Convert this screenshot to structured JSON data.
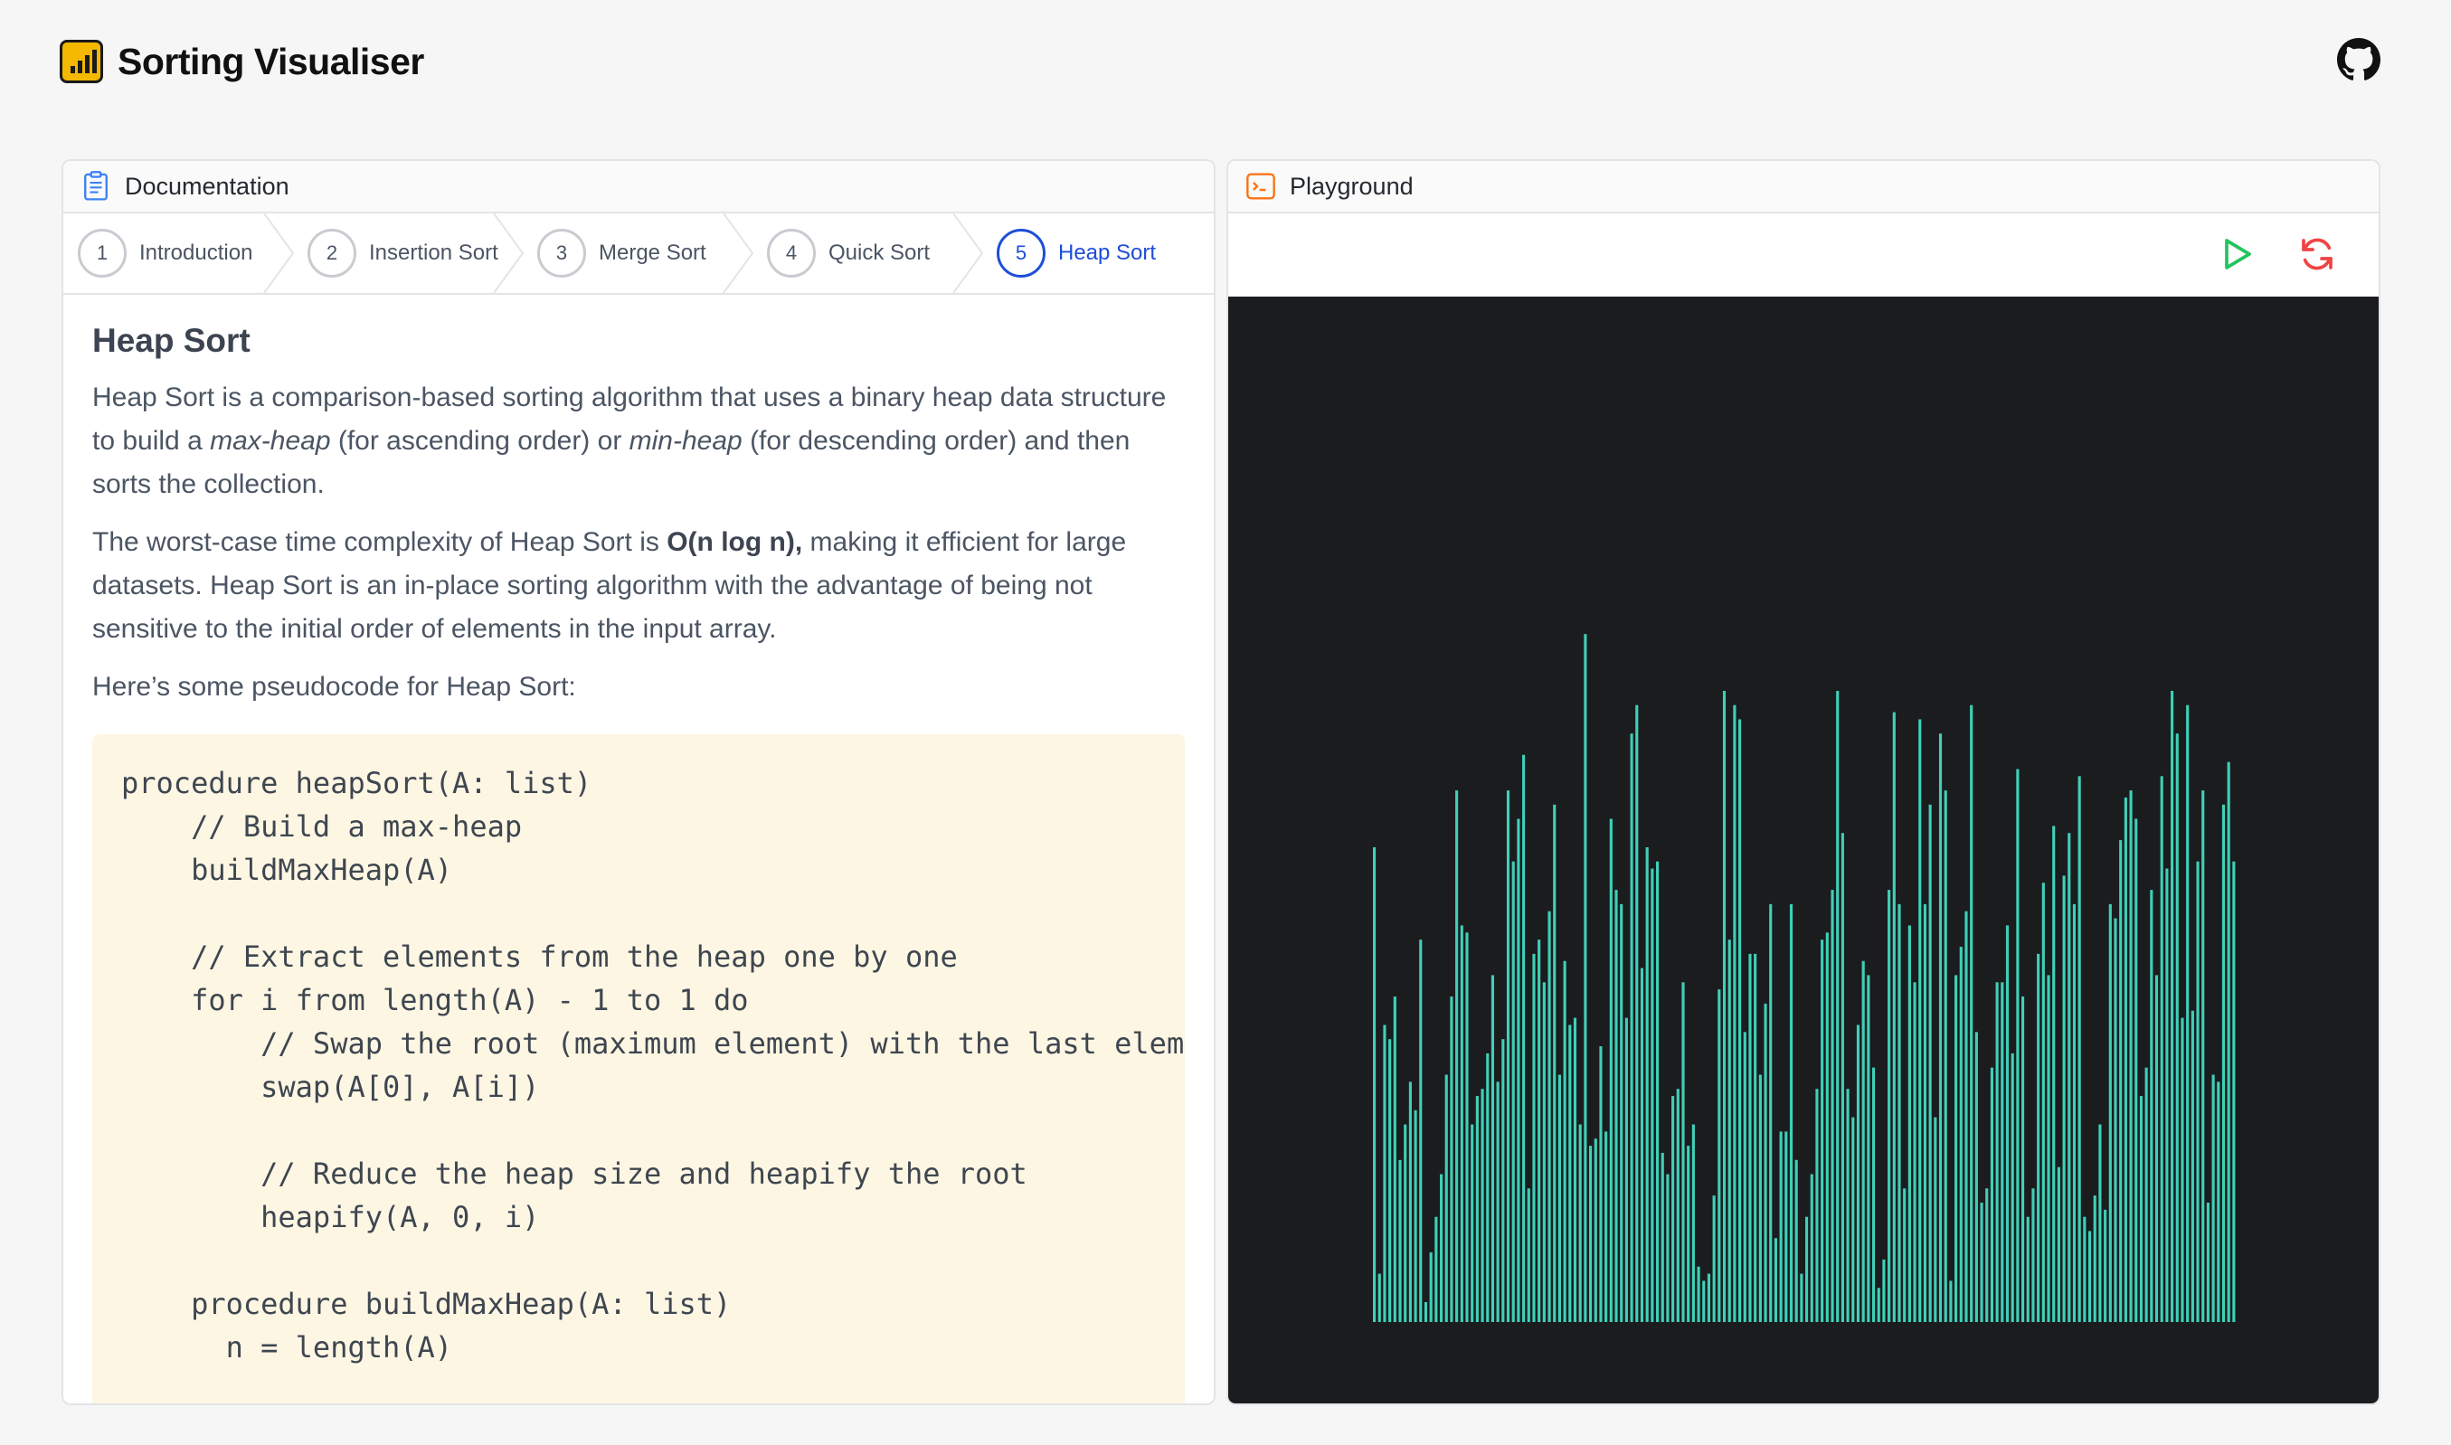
{
  "app": {
    "title": "Sorting Visualiser"
  },
  "icons": {
    "logo": "bar-chart-icon",
    "github": "github-icon",
    "docs": "clipboard-icon",
    "playground": "terminal-icon",
    "run": "play-icon",
    "reset": "refresh-icon"
  },
  "colors": {
    "accent": "#1d4ed8",
    "logo": "#f5b800",
    "bar": "#3fd0b8",
    "run": "#22c55e",
    "reset": "#ef4444",
    "canvas_bg": "#1b1c1e",
    "code_bg": "#fdf6e3"
  },
  "documentation": {
    "title": "Documentation",
    "steps": [
      {
        "num": "1",
        "label": "Introduction"
      },
      {
        "num": "2",
        "label": "Insertion Sort"
      },
      {
        "num": "3",
        "label": "Merge Sort"
      },
      {
        "num": "4",
        "label": "Quick Sort"
      },
      {
        "num": "5",
        "label": "Heap Sort"
      }
    ],
    "active_step": 5,
    "heading": "Heap Sort",
    "p1_a": "Heap Sort is a comparison-based sorting algorithm that uses a binary heap data structure to build a ",
    "p1_em1": "max-heap",
    "p1_b": " (for ascending order) or ",
    "p1_em2": "min-heap",
    "p1_c": " (for descending order) and then sorts the collection.",
    "p2_a": "The worst-case time complexity of Heap Sort is ",
    "p2_bold": "O(n log n),",
    "p2_b": " making it efficient for large datasets. Heap Sort is an in-place sorting algorithm with the advantage of being not sensitive to the initial order of elements in the input array.",
    "p3": "Here’s some pseudocode for Heap Sort:",
    "code": "procedure heapSort(A: list)\n    // Build a max-heap\n    buildMaxHeap(A)\n\n    // Extract elements from the heap one by one\n    for i from length(A) - 1 to 1 do\n        // Swap the root (maximum element) with the last element\n        swap(A[0], A[i])\n\n        // Reduce the heap size and heapify the root\n        heapify(A, 0, i)\n\n    procedure buildMaxHeap(A: list)\n      n = length(A)"
  },
  "playground": {
    "title": "Playground",
    "bars": [
      64,
      4,
      39,
      37,
      43,
      20,
      25,
      31,
      27,
      51,
      0,
      7,
      12,
      18,
      32,
      43,
      72,
      53,
      52,
      25,
      29,
      30,
      35,
      46,
      31,
      37,
      72,
      62,
      68,
      77,
      16,
      49,
      51,
      45,
      55,
      70,
      32,
      48,
      39,
      40,
      25,
      94,
      22,
      23,
      36,
      24,
      68,
      58,
      56,
      40,
      80,
      84,
      47,
      64,
      61,
      62,
      21,
      18,
      29,
      30,
      45,
      22,
      25,
      5,
      3,
      4,
      15,
      44,
      86,
      51,
      84,
      82,
      38,
      49,
      49,
      32,
      42,
      56,
      9,
      24,
      24,
      56,
      20,
      4,
      12,
      18,
      30,
      51,
      52,
      58,
      86,
      66,
      30,
      26,
      39,
      48,
      46,
      33,
      2,
      6,
      58,
      83,
      56,
      16,
      53,
      45,
      82,
      56,
      70,
      26,
      80,
      72,
      3,
      46,
      50,
      55,
      84,
      38,
      14,
      16,
      33,
      45,
      45,
      53,
      35,
      75,
      43,
      12,
      16,
      49,
      59,
      46,
      67,
      19,
      60,
      66,
      56,
      74,
      12,
      10,
      15,
      25,
      13,
      56,
      54,
      65,
      71,
      72,
      68,
      29,
      33,
      58,
      46,
      74,
      61,
      86,
      80,
      40,
      84,
      41,
      62,
      72,
      14,
      32,
      31,
      70,
      76,
      62
    ]
  }
}
